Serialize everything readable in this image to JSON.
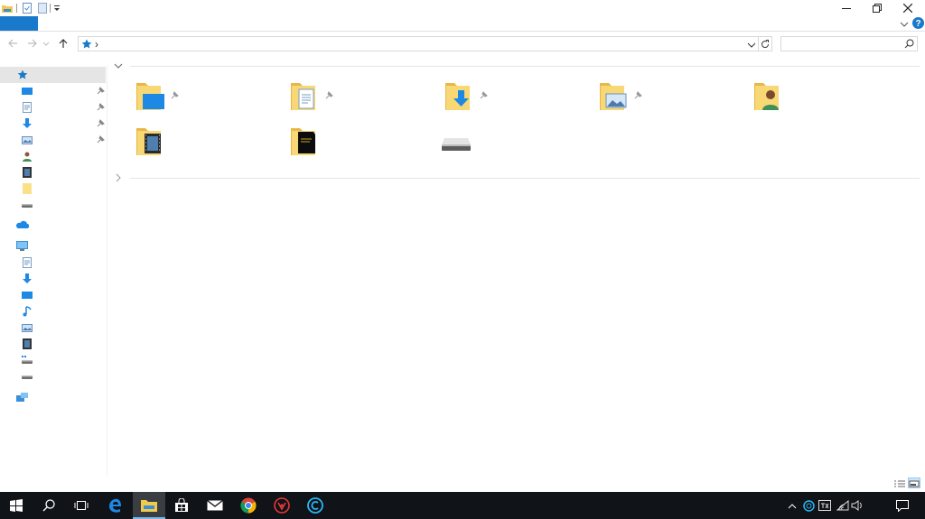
{
  "window": {
    "title": "",
    "controls": {
      "minimize_icon": "minimize-icon",
      "restore_icon": "restore-icon",
      "close_icon": "close-icon"
    }
  },
  "quick_access_toolbar": [
    "folder-icon",
    "properties-icon",
    "new-folder-icon",
    "customize-dropdown-icon"
  ],
  "ribbon": {
    "file_tab_color": "#1979ca",
    "file_tab_label": "",
    "expand_icon": "chevron-down-icon",
    "help_icon": "help-icon"
  },
  "navigation": {
    "back_icon": "arrow-left-icon",
    "forward_icon": "arrow-right-icon",
    "recent_icon": "chevron-down-icon",
    "up_icon": "arrow-up-icon",
    "address": {
      "root_icon": "quick-access-star-icon",
      "separator": "›",
      "path_text": ""
    },
    "refresh_icon": "refresh-icon",
    "search_placeholder": "",
    "search_icon": "search-icon"
  },
  "nav_pane": {
    "quick_access": {
      "icon": "quick-access-star-icon",
      "label": "",
      "selected": true
    },
    "pinned": [
      {
        "icon": "desktop-icon",
        "label": "",
        "pinned": true
      },
      {
        "icon": "documents-icon",
        "label": "",
        "pinned": true
      },
      {
        "icon": "downloads-icon",
        "label": "",
        "pinned": true
      },
      {
        "icon": "pictures-icon",
        "label": "",
        "pinned": true
      },
      {
        "icon": "user-folder-icon",
        "label": "",
        "pinned": false
      },
      {
        "icon": "videos-icon",
        "label": "",
        "pinned": false
      },
      {
        "icon": "folder-icon",
        "label": "",
        "pinned": false
      },
      {
        "icon": "drive-icon",
        "label": "",
        "pinned": false
      }
    ],
    "onedrive": {
      "icon": "onedrive-icon",
      "label": ""
    },
    "this_pc": {
      "icon": "this-pc-icon",
      "label": "",
      "children": [
        {
          "icon": "documents-icon",
          "label": ""
        },
        {
          "icon": "downloads-icon",
          "label": ""
        },
        {
          "icon": "desktop-icon",
          "label": ""
        },
        {
          "icon": "music-icon",
          "label": ""
        },
        {
          "icon": "pictures-icon",
          "label": ""
        },
        {
          "icon": "videos-icon",
          "label": ""
        },
        {
          "icon": "local-disk-icon",
          "label": ""
        },
        {
          "icon": "drive-icon",
          "label": ""
        }
      ]
    },
    "network": {
      "icon": "network-icon",
      "label": ""
    }
  },
  "content": {
    "frequent_folders_header": {
      "icon": "chevron-down-icon",
      "label": ""
    },
    "folders": [
      {
        "icon": "desktop-folder-icon",
        "label": "",
        "pinned": true
      },
      {
        "icon": "documents-folder-icon",
        "label": "",
        "pinned": true
      },
      {
        "icon": "downloads-folder-icon",
        "label": "",
        "pinned": true
      },
      {
        "icon": "pictures-folder-icon",
        "label": "",
        "pinned": true
      },
      {
        "icon": "user-folder-icon",
        "label": "",
        "pinned": false
      },
      {
        "icon": "videos-folder-icon",
        "label": "",
        "pinned": false
      },
      {
        "icon": "dark-folder-icon",
        "label": "",
        "pinned": false
      },
      {
        "icon": "drive-icon",
        "label": "",
        "pinned": false
      }
    ],
    "recent_files_header": {
      "icon": "chevron-right-icon",
      "label": ""
    }
  },
  "status_bar": {
    "details_view_icon": "details-view-icon",
    "large_icons_view_icon": "large-icons-view-icon"
  },
  "taskbar": {
    "background": "#101318",
    "buttons": [
      {
        "icon": "windows-start-icon",
        "active": false
      },
      {
        "icon": "search-icon",
        "active": false
      },
      {
        "icon": "task-view-icon",
        "active": false
      },
      {
        "icon": "edge-icon",
        "active": false
      },
      {
        "icon": "file-explorer-icon",
        "active": true
      },
      {
        "icon": "store-icon",
        "active": false
      },
      {
        "icon": "mail-icon",
        "active": false
      },
      {
        "icon": "chrome-icon",
        "active": false
      },
      {
        "icon": "red-app-icon",
        "active": false
      },
      {
        "icon": "blue-app-icon",
        "active": false
      }
    ],
    "tray": [
      "show-hidden-icons-icon",
      "cortana-tray-icon",
      "ime-icon",
      "wifi-icon",
      "volume-icon",
      "action-center-icon"
    ]
  }
}
